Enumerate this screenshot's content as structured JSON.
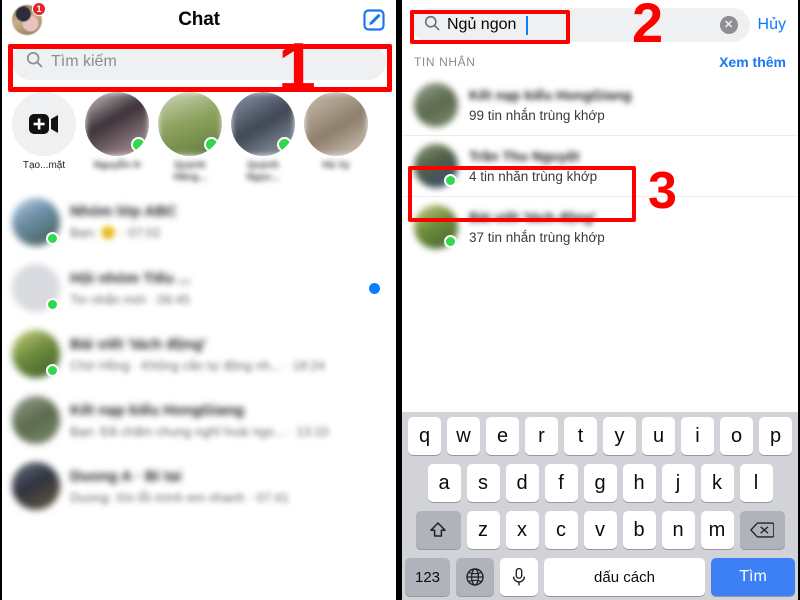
{
  "left_panel": {
    "header": {
      "title": "Chat",
      "avatar_badge": "1",
      "avatar_icon": "profile-avatar",
      "compose_icon": "compose-icon"
    },
    "search": {
      "placeholder": "Tìm kiếm",
      "icon": "search-icon"
    },
    "stories": [
      {
        "label": "Tạo...mặt",
        "icon": "create-room-video-icon",
        "blurred": false,
        "online": false
      },
      {
        "label": "Nguyễn H",
        "blurred": true,
        "online": true
      },
      {
        "label": "Quỳnh Hằng...",
        "blurred": true,
        "online": true
      },
      {
        "label": "Quỳnh Ngọc...",
        "blurred": true,
        "online": true
      },
      {
        "label": "Hà Vy",
        "blurred": true,
        "online": false
      }
    ],
    "chats": [
      {
        "name": "Nhóm lớp ABC",
        "snippet": "Bạn: 🙂 · 07:02",
        "online": true,
        "unread": false
      },
      {
        "name": "Hội nhóm Tiếu ...",
        "snippet": "Tin nhắn mới · 06:45",
        "online": true,
        "unread": true
      },
      {
        "name": "Bài viết 'tách động'",
        "snippet": "Chờ Hồng · Không cần tự động nh... · 18:24",
        "online": true,
        "unread": false
      },
      {
        "name": "Kết nạp kiểu HongGiang",
        "snippet": "Bạn: Đã chấm chung nghĩ hoài ngo... · 13:10",
        "online": false,
        "unread": false
      },
      {
        "name": "Duong A · Bí tai",
        "snippet": "Duong: Xin lỗi mình em nhanh · 07:41",
        "online": false,
        "unread": false
      }
    ]
  },
  "right_panel": {
    "search": {
      "value": "Ngủ ngon",
      "icon": "search-icon",
      "clear_icon": "clear-circle-icon",
      "cancel_label": "Hủy"
    },
    "section": {
      "title": "TIN NHẮN",
      "see_more_label": "Xem thêm"
    },
    "results": [
      {
        "name": "Kết nạp kiểu HongGiang",
        "match_text": "99 tin nhắn trùng khớp",
        "online": false,
        "highlighted": false
      },
      {
        "name": "Trần Thu Nguyệt",
        "match_text": "4 tin nhắn trùng khớp",
        "online": true,
        "highlighted": true
      },
      {
        "name": "Bài viết 'tách động'",
        "match_text": "37 tin nhắn trùng khớp",
        "online": true,
        "highlighted": false
      }
    ],
    "keyboard": {
      "row1": [
        "q",
        "w",
        "e",
        "r",
        "t",
        "y",
        "u",
        "i",
        "o",
        "p"
      ],
      "row2": [
        "a",
        "s",
        "d",
        "f",
        "g",
        "h",
        "j",
        "k",
        "l"
      ],
      "row3": [
        "z",
        "x",
        "c",
        "v",
        "b",
        "n",
        "m"
      ],
      "shift_icon": "shift-arrow-icon",
      "delete_icon": "backspace-icon",
      "numbers_label": "123",
      "globe_icon": "globe-icon",
      "mic_icon": "microphone-icon",
      "space_label": "dấu cách",
      "go_label": "Tìm"
    }
  },
  "annotations": [
    {
      "number": "1",
      "target": "left-search-bar"
    },
    {
      "number": "2",
      "target": "right-search-input"
    },
    {
      "number": "3",
      "target": "search-result-row-2"
    }
  ],
  "colors": {
    "accent_blue": "#0a7cff",
    "link_blue": "#1877f2",
    "annotation_red": "#ff0000",
    "online_green": "#31d84a",
    "key_blue": "#3d80f5",
    "field_gray": "#eff0f2",
    "keyboard_bg": "#d1d3d9"
  }
}
